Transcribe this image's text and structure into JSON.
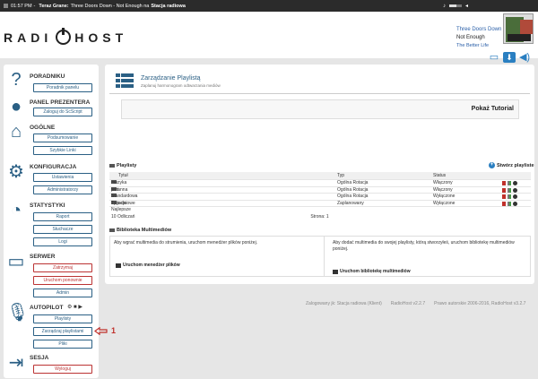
{
  "topbar": {
    "time": "01:57 PM",
    "sep1": "-",
    "now_label": "Teraz Grane:",
    "track": "Three Doors Down - Not Enough na",
    "station": "Stacja radiowa"
  },
  "header": {
    "logo_left": "RADI",
    "logo_right": "HOST",
    "now_playing": {
      "artist": "Three Doors Down",
      "song": "Not Enough",
      "album": "The Better Life"
    }
  },
  "sidebar": {
    "sections": [
      {
        "title": "PORADNIKU",
        "buttons": [
          "Poradnik panelu"
        ]
      },
      {
        "title": "PANEL PREZENTERA",
        "buttons": [
          "Zaloguj do ScScript"
        ]
      },
      {
        "title": "OGÓLNE",
        "buttons": [
          "Podsumowanie",
          "Szybkie Linki"
        ]
      },
      {
        "title": "KONFIGURACJA",
        "buttons": [
          "Ustawienia",
          "Administratorzy"
        ]
      },
      {
        "title": "STATYSTYKI",
        "buttons": [
          "Raport",
          "Słuchacze",
          "Logi"
        ]
      },
      {
        "title": "SERWER",
        "buttons": [
          "Zatrzymaj",
          "Uruchom ponownie",
          "Admin"
        ]
      },
      {
        "title": "AUTOPILOT",
        "buttons": [
          "Playlisty",
          "Zarządzaj playlistami",
          "Pliki"
        ]
      },
      {
        "title": "SESJA",
        "buttons": [
          "Wyloguj"
        ]
      }
    ],
    "autopilot_controls": "⚙ ■ ▶"
  },
  "callout": {
    "number": "1"
  },
  "main": {
    "title": "Zarządzanie Playlistą",
    "subtitle": "Zaplanuj harmonogram odtwarzania mediów",
    "tutorial_button": "Pokaż Tutorial",
    "playlists_heading": "Playlisty",
    "create_playlist": "Stwórz playliste",
    "columns": [
      "Tytuł",
      "Typ",
      "Status"
    ],
    "rows": [
      {
        "name": "muzyka poranna",
        "type": "Ogólna Rotacja",
        "status": "Włączony"
      },
      {
        "name": "test",
        "type": "Ogólna Rotacja",
        "status": "Włączony"
      },
      {
        "name": "Standardowa Rotacja",
        "type": "Ogólna Rotacja",
        "status": "Wyłączone"
      },
      {
        "name": "Tygodniowe Najlepsze 10 Odliczań",
        "type": "Zaplanowany",
        "status": "Wyłączone"
      }
    ],
    "pager": "Strona: 1",
    "media_heading": "Biblioteka Multimediów",
    "media_left_text": "Aby wgrać multimedia do strumienia, uruchom menedżer plików poniżej.",
    "media_left_link": "Uruchom menedżer plików",
    "media_right_text": "Aby dodać multimedia do swojej playlisty, którą stworzyłeś, uruchom bibliotekę multimediów poniżej.",
    "media_right_link": "Uruchom bibliotekę multimediów"
  },
  "footer": {
    "logged": "Zalogowany jk: Stacja radiowa (Klient)",
    "version": "RadioHost v2.2.7",
    "copyright": "Prawo autorskie 2006-2016, RadioHost v3.2.7"
  }
}
